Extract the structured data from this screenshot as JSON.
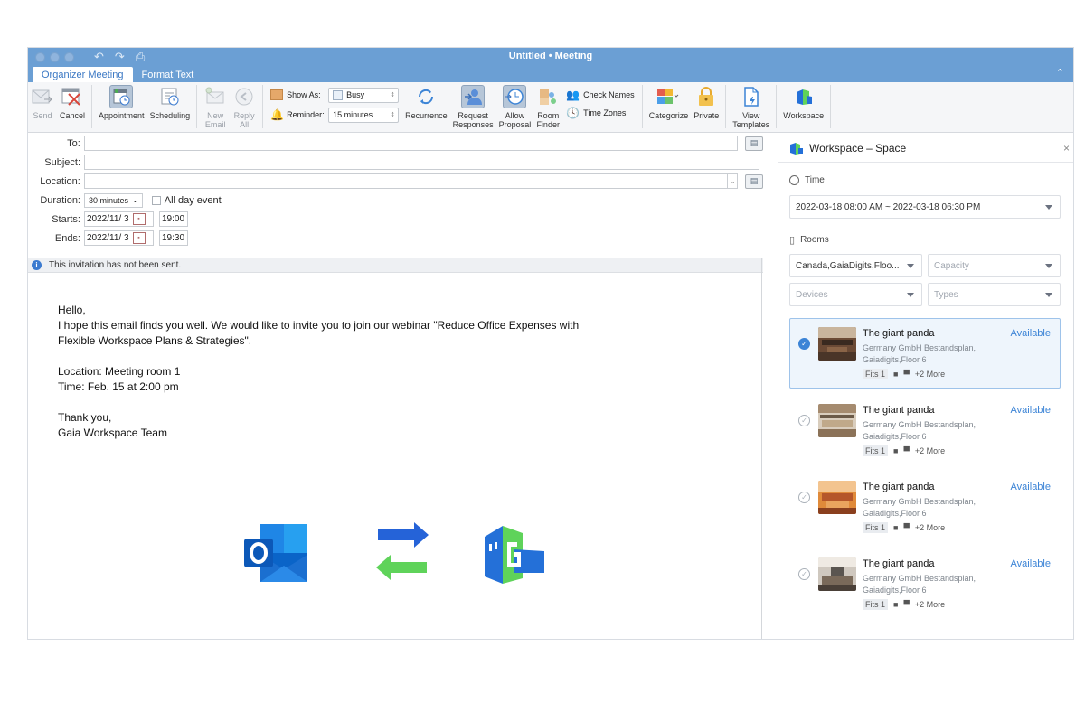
{
  "window": {
    "title": "Untitled • Meeting",
    "tabs": [
      "Organizer Meeting",
      "Format Text"
    ]
  },
  "ribbon": {
    "send": "Send",
    "cancel": "Cancel",
    "appointment": "Appointment",
    "scheduling": "Scheduling",
    "new_email": [
      "New",
      "Email"
    ],
    "reply_all": [
      "Reply",
      "All"
    ],
    "show_as_label": "Show As:",
    "show_as_value": "Busy",
    "reminder_label": "Reminder:",
    "reminder_value": "15 minutes",
    "recurrence": "Recurrence",
    "request_responses": [
      "Request",
      "Responses"
    ],
    "allow_proposal": [
      "Allow",
      "Proposal"
    ],
    "room_finder": [
      "Room",
      "Finder"
    ],
    "check_names": "Check Names",
    "time_zones": "Time Zones",
    "categorize": "Categorize",
    "private": "Private",
    "view_templates": [
      "View",
      "Templates"
    ],
    "workspace": "Workspace"
  },
  "form": {
    "to_label": "To:",
    "subject_label": "Subject:",
    "location_label": "Location:",
    "duration_label": "Duration:",
    "duration_value": "30 minutes",
    "all_day_label": "All day event",
    "starts_label": "Starts:",
    "starts_date": "2022/11/ 3",
    "starts_time": "19:00",
    "ends_label": "Ends:",
    "ends_date": "2022/11/ 3",
    "ends_time": "19:30"
  },
  "info": "This invitation has not been sent.",
  "body": {
    "lines": [
      "Hello,",
      "I hope this email finds you well. We would like to invite you to join our webinar \"Reduce Office Expenses with",
      "Flexible Workspace Plans & Strategies\".",
      "",
      "Location: Meeting room 1",
      "Time: Feb. 15 at 2:00 pm",
      "",
      "Thank you,",
      "Gaia Workspace Team"
    ]
  },
  "panel": {
    "title": "Workspace – Space",
    "time_label": "Time",
    "time_value": "2022-03-18 08:00 AM ~ 2022-03-18 06:30 PM",
    "rooms_label": "Rooms",
    "filter_location": "Canada,GaiaDigits,Floo...",
    "filter_capacity": "Capacity",
    "filter_devices": "Devices",
    "filter_types": "Types",
    "rooms": [
      {
        "name": "The giant panda",
        "status": "Available",
        "line1": "Germany GmbH Bestandsplan,",
        "line2": "Gaiadigits,Floor 6",
        "fits": "Fits 1",
        "more": "+2 More",
        "selected": true
      },
      {
        "name": "The giant panda",
        "status": "Available",
        "line1": "Germany GmbH Bestandsplan,",
        "line2": "Gaiadigits,Floor 6",
        "fits": "Fits 1",
        "more": "+2 More",
        "selected": false
      },
      {
        "name": "The giant panda",
        "status": "Available",
        "line1": "Germany GmbH Bestandsplan,",
        "line2": "Gaiadigits,Floor 6",
        "fits": "Fits 1",
        "more": "+2 More",
        "selected": false
      },
      {
        "name": "The giant panda",
        "status": "Available",
        "line1": "Germany GmbH Bestandsplan,",
        "line2": "Gaiadigits,Floor 6",
        "fits": "Fits 1",
        "more": "+2 More",
        "selected": false
      }
    ]
  },
  "colors": {
    "titlebar": "#6b9fd4",
    "accent": "#3c84d6",
    "outlook_blue": "#1a66c9",
    "arrow_blue": "#2563d8",
    "arrow_green": "#5fd35a",
    "gaia_blue": "#2470d8",
    "gaia_green": "#5fd35a"
  }
}
